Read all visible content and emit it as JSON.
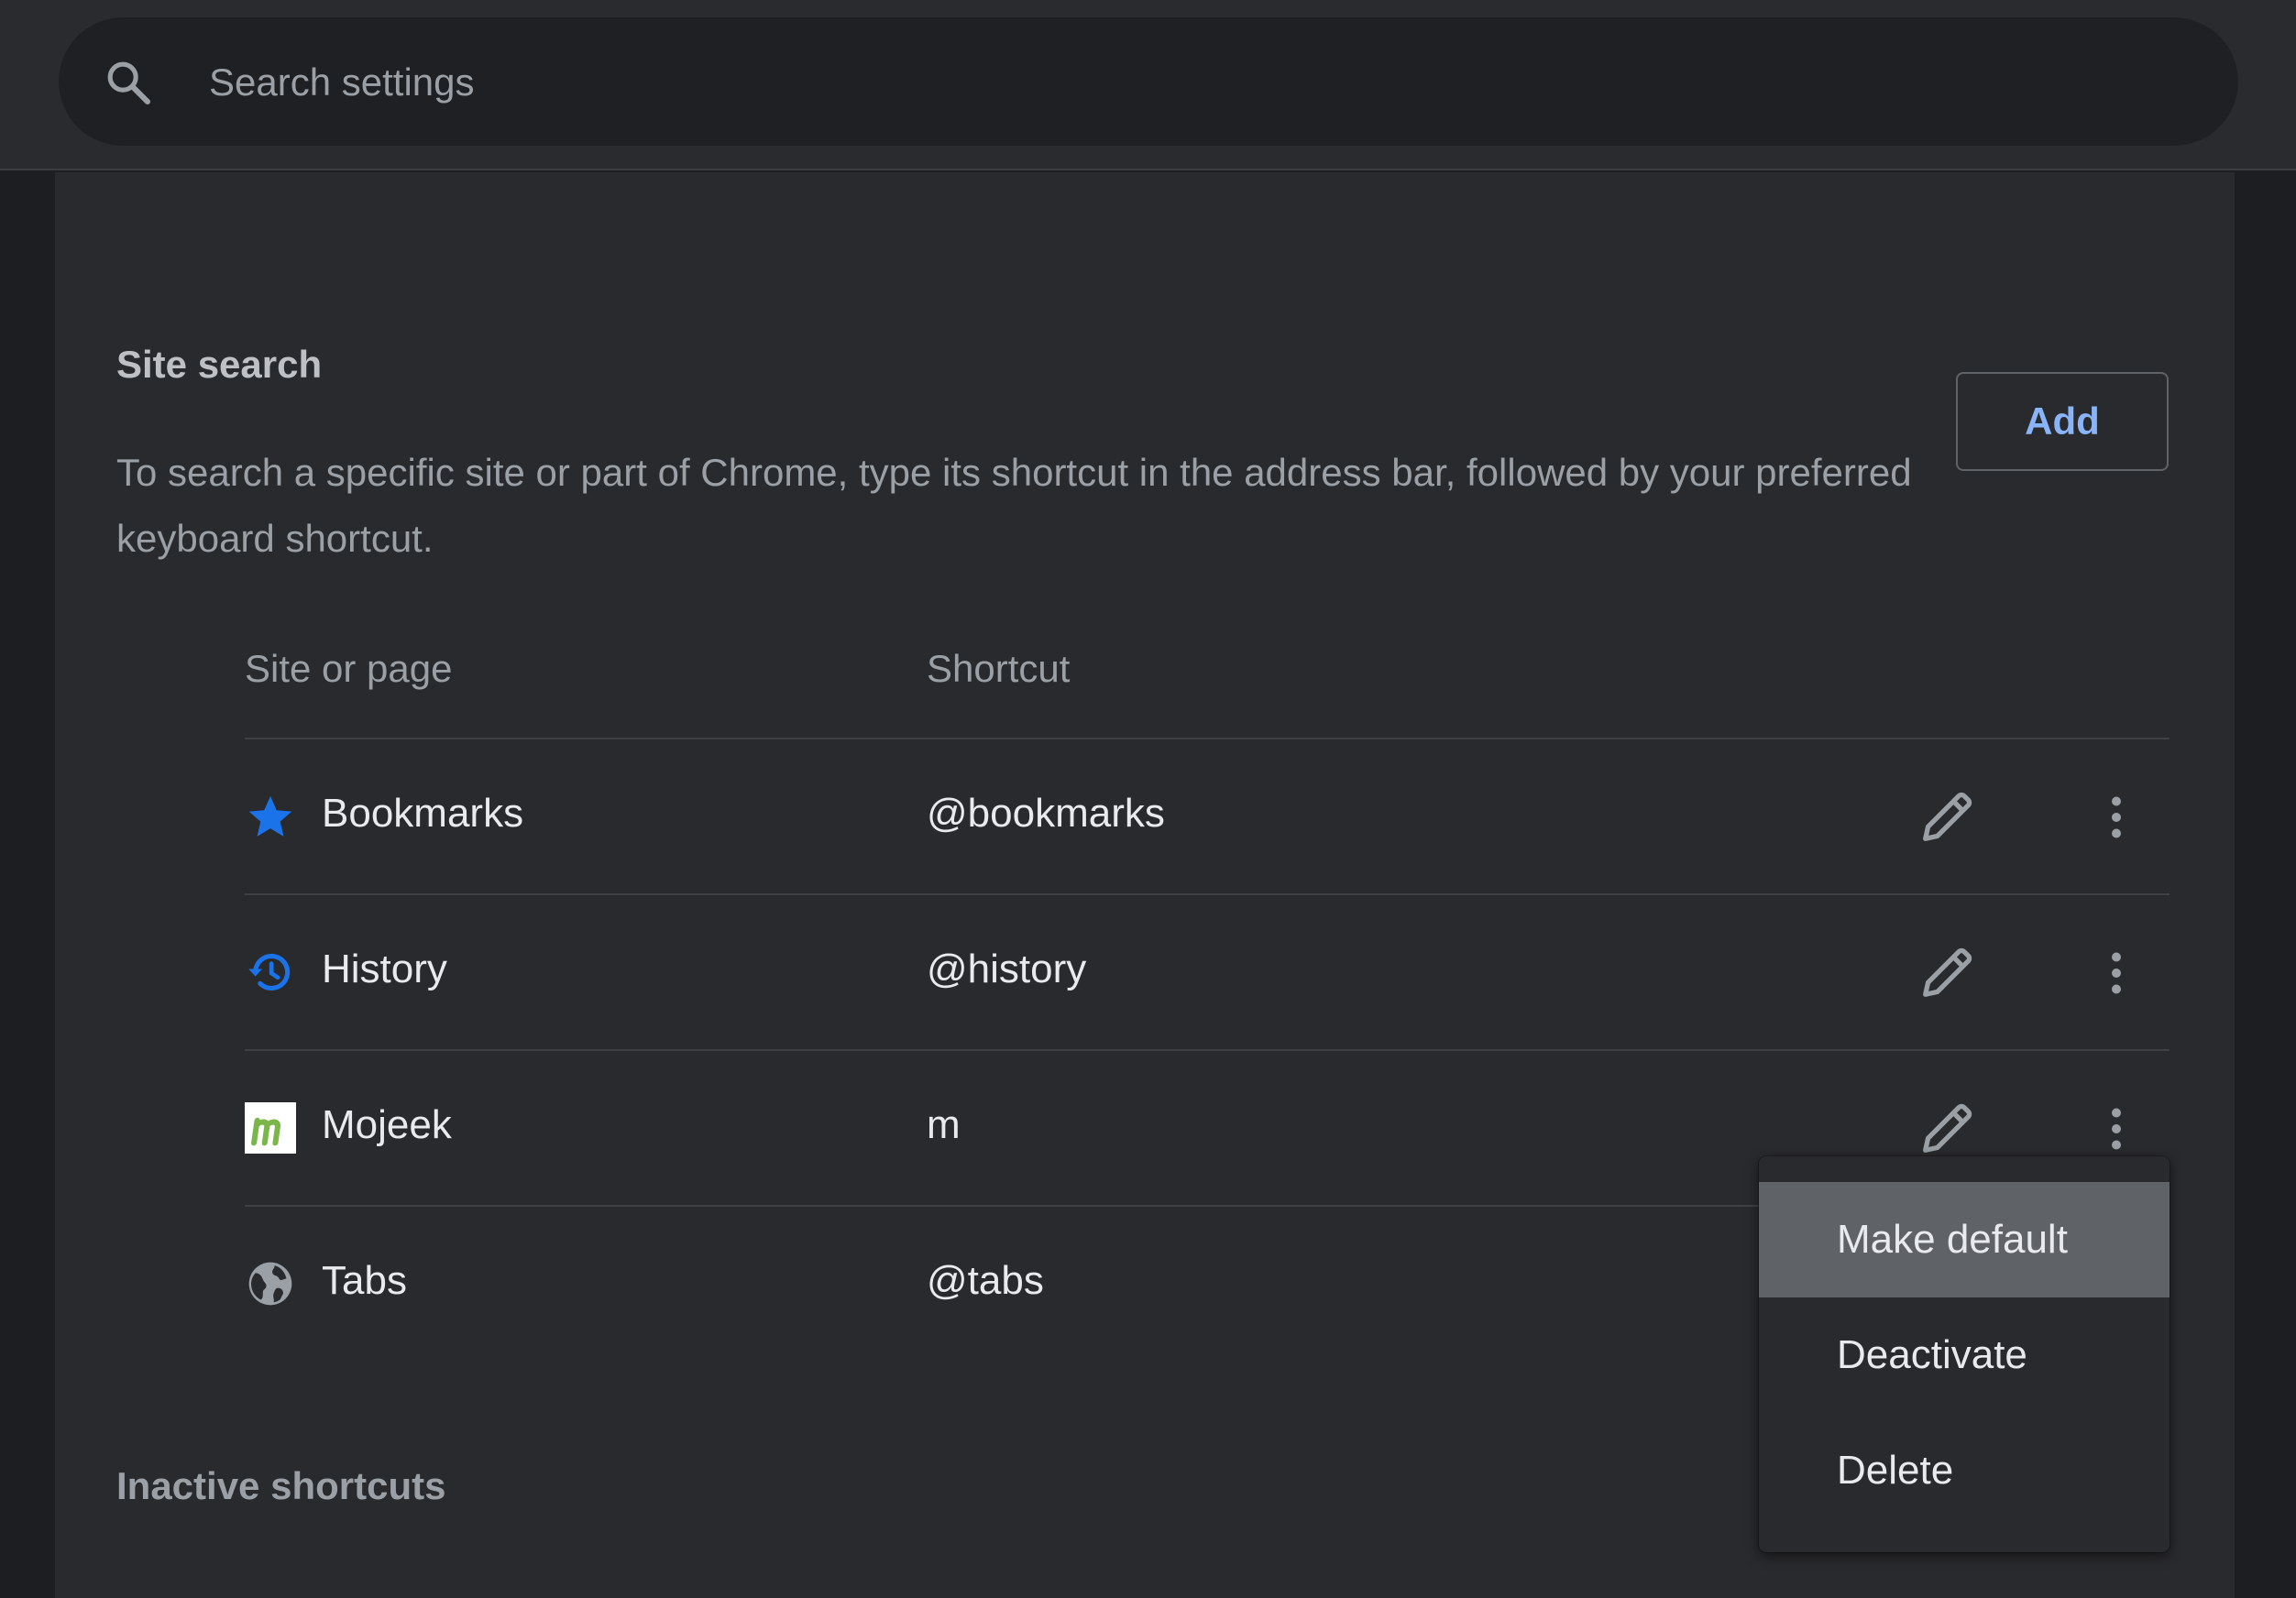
{
  "search": {
    "placeholder": "Search settings",
    "icon": "search-icon"
  },
  "site_search": {
    "title": "Site search",
    "description": "To search a specific site or part of Chrome, type its shortcut in the address bar, followed by your preferred keyboard shortcut.",
    "add_label": "Add"
  },
  "table": {
    "headers": {
      "site": "Site or page",
      "shortcut": "Shortcut"
    },
    "rows": [
      {
        "name": "Bookmarks",
        "shortcut": "@bookmarks",
        "icon": "star-icon",
        "icon_color": "#1a73e8"
      },
      {
        "name": "History",
        "shortcut": "@history",
        "icon": "history-icon",
        "icon_color": "#1a73e8"
      },
      {
        "name": "Mojeek",
        "shortcut": "m",
        "icon": "mojeek-logo-icon",
        "icon_color": "#7ab648"
      },
      {
        "name": "Tabs",
        "shortcut": "@tabs",
        "icon": "globe-icon",
        "icon_color": "#9aa0a6"
      }
    ]
  },
  "inactive": {
    "title": "Inactive shortcuts"
  },
  "menu": {
    "items": [
      {
        "label": "Make default",
        "highlighted": true
      },
      {
        "label": "Deactivate",
        "highlighted": false
      },
      {
        "label": "Delete",
        "highlighted": false
      }
    ]
  },
  "colors": {
    "accent": "#8ab4f8",
    "background": "#1d1e21",
    "card": "#292a2d",
    "text": "#e8eaed",
    "muted_text": "#9aa0a6"
  }
}
